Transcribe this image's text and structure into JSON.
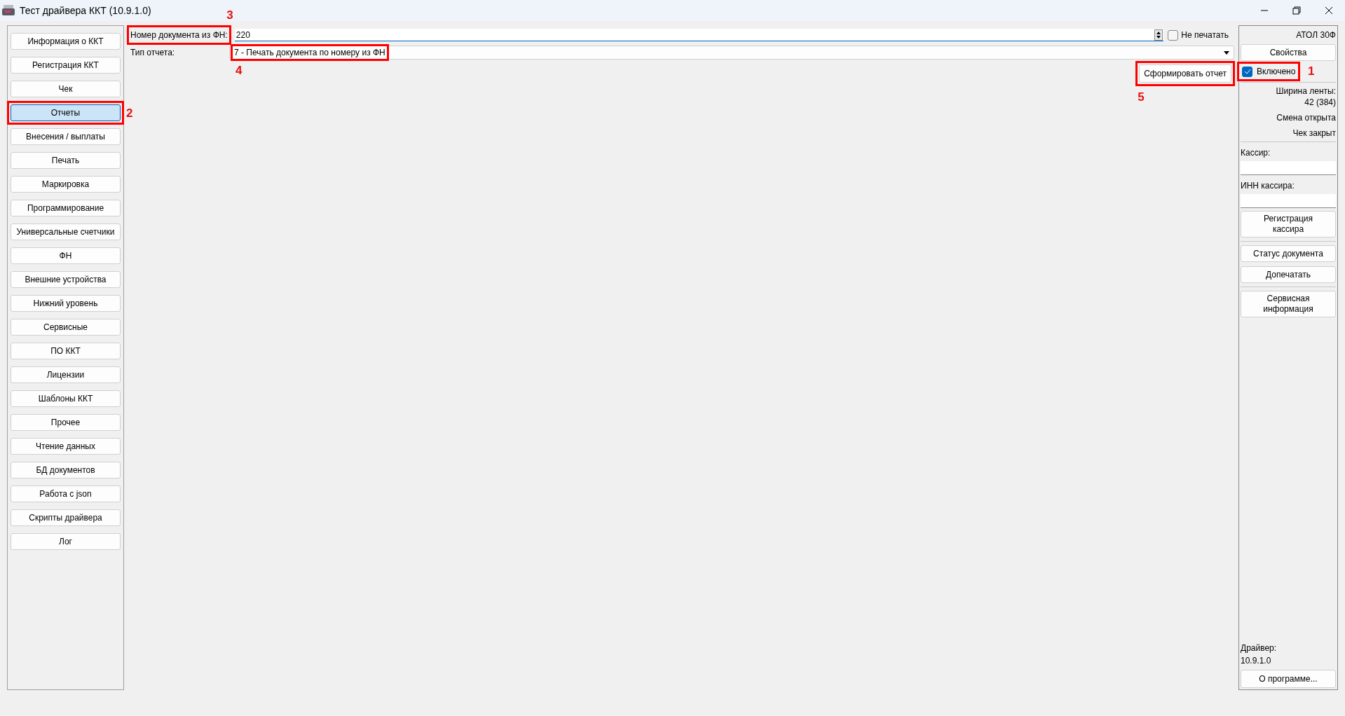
{
  "window": {
    "title": "Тест драйвера ККТ (10.9.1.0)"
  },
  "sidebar": {
    "items": [
      {
        "label": "Информация о ККТ",
        "selected": false
      },
      {
        "label": "Регистрация ККТ",
        "selected": false
      },
      {
        "label": "Чек",
        "selected": false
      },
      {
        "label": "Отчеты",
        "selected": true,
        "callout": "2"
      },
      {
        "label": "Внесения / выплаты",
        "selected": false
      },
      {
        "label": "Печать",
        "selected": false
      },
      {
        "label": "Маркировка",
        "selected": false
      },
      {
        "label": "Программирование",
        "selected": false
      },
      {
        "label": "Универсальные счетчики",
        "selected": false
      },
      {
        "label": "ФН",
        "selected": false
      },
      {
        "label": "Внешние устройства",
        "selected": false
      },
      {
        "label": "Нижний уровень",
        "selected": false
      },
      {
        "label": "Сервисные",
        "selected": false
      },
      {
        "label": "ПО ККТ",
        "selected": false
      },
      {
        "label": "Лицензии",
        "selected": false
      },
      {
        "label": "Шаблоны ККТ",
        "selected": false
      },
      {
        "label": "Прочее",
        "selected": false
      },
      {
        "label": "Чтение данных",
        "selected": false
      },
      {
        "label": "БД документов",
        "selected": false
      },
      {
        "label": "Работа с json",
        "selected": false
      },
      {
        "label": "Скрипты драйвера",
        "selected": false
      },
      {
        "label": "Лог",
        "selected": false
      }
    ]
  },
  "form": {
    "doc_number": {
      "label": "Номер документа из ФН:",
      "value": "220",
      "callout": "3"
    },
    "no_print": {
      "label": "Не печатать",
      "checked": false
    },
    "report_type": {
      "label": "Тип отчета:",
      "value": "7 - Печать документа по номеру из ФН",
      "callout": "4"
    },
    "submit": {
      "label": "Сформировать отчет",
      "callout": "5"
    }
  },
  "device_panel": {
    "model": "АТОЛ 30Ф",
    "properties_button": "Свойства",
    "enabled": {
      "label": "Включено",
      "checked": true,
      "callout": "1"
    },
    "status_lines": [
      "Ширина ленты:",
      "42 (384)",
      "Смена открыта",
      "Чек закрыт"
    ],
    "cashier_label": "Кассир:",
    "cashier_inn_label": "ИНН кассира:",
    "register_cashier_button": "Регистрация кассира",
    "buttons": [
      "Статус документа",
      "Допечатать"
    ],
    "service_info_button": "Сервисная информация",
    "driver_label": "Драйвер:",
    "driver_version": "10.9.1.0",
    "about_button": "О программе..."
  }
}
